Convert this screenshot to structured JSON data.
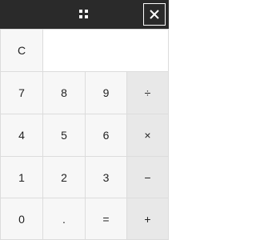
{
  "titlebar": {
    "menu_icon": "grid-menu-icon",
    "close_icon": "close-icon",
    "background": "#2a2a2a"
  },
  "display": {
    "value": ""
  },
  "keys": {
    "clear": "C",
    "seven": "7",
    "eight": "8",
    "nine": "9",
    "divide": "÷",
    "four": "4",
    "five": "5",
    "six": "6",
    "multiply": "×",
    "one": "1",
    "two": "2",
    "three": "3",
    "subtract": "−",
    "zero": "0",
    "decimal": ".",
    "equals": "=",
    "add": "+"
  },
  "colors": {
    "key_bg": "#f7f7f7",
    "operator_bg": "#e8e8e8",
    "divider": "#dcdcdc"
  }
}
